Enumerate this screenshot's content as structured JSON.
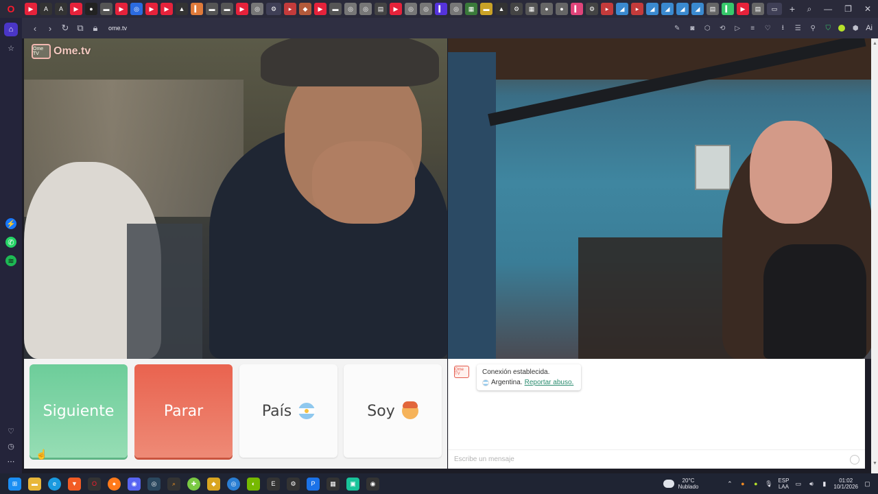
{
  "browser": {
    "url": "ome.tv",
    "ai_label": "Ai"
  },
  "site": {
    "logo_text": "Ome.tv",
    "logo_badge": "Ome TV"
  },
  "controls": {
    "next_label": "Siguiente",
    "stop_label": "Parar",
    "country_label": "País",
    "gender_label": "Soy"
  },
  "chat": {
    "avatar_label": "Ome TV",
    "status": "Conexión establecida.",
    "country": "Argentina.",
    "report_link": "Reportar abuso.",
    "input_placeholder": "Escribe un mensaje"
  },
  "taskbar": {
    "temperature": "20°C",
    "weather": "Nublado",
    "language_top": "ESP",
    "language_bottom": "LAA",
    "time": "01:02",
    "date": "10/1/2026"
  },
  "colors": {
    "next_button": "#6dcd9a",
    "stop_button": "#e9634f",
    "opera_red": "#ff1b2d",
    "sidebar_accent": "#4a36c8"
  }
}
